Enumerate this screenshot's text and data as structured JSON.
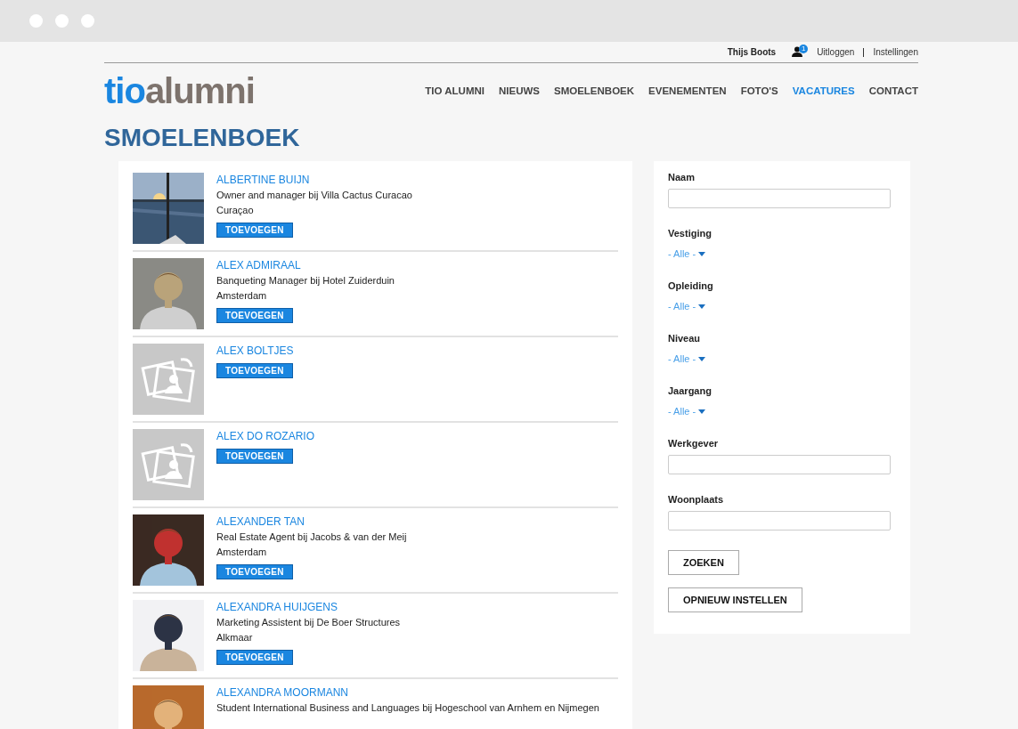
{
  "top_bar": {
    "user_name": "Thijs Boots",
    "notification_count": "1",
    "links": [
      "Uitloggen",
      "Instellingen"
    ]
  },
  "logo": {
    "part_1": "tio",
    "part_2": "alumni"
  },
  "nav": [
    {
      "label": "TIO ALUMNI",
      "selected": false
    },
    {
      "label": "NIEUWS",
      "selected": false
    },
    {
      "label": "SMOELENBOEK",
      "selected": false
    },
    {
      "label": "EVENEMENTEN",
      "selected": false
    },
    {
      "label": "FOTO'S",
      "selected": false
    },
    {
      "label": "VACATURES",
      "selected": true
    },
    {
      "label": "CONTACT",
      "selected": false
    }
  ],
  "page_title": "SMOELENBOEK",
  "people": [
    {
      "kind": "picture",
      "name": "ALBERTINE BUIJN",
      "job": "Owner and manager bij Villa Cactus Curacao",
      "city": "Curaçao",
      "button": "TOEVOEGEN"
    },
    {
      "kind": "picture",
      "name": "ALEX ADMIRAAL",
      "job": "Banqueting Manager bij Hotel Zuiderduin",
      "city": "Amsterdam",
      "button": "TOEVOEGEN"
    },
    {
      "kind": "placeholder",
      "name": "ALEX BOLTJES",
      "button": "TOEVOEGEN"
    },
    {
      "kind": "placeholder",
      "name": "ALEX DO ROZARIO",
      "button": "TOEVOEGEN"
    },
    {
      "kind": "picture",
      "name": "ALEXANDER TAN",
      "job": "Real Estate Agent bij Jacobs & van der Meij",
      "city": "Amsterdam",
      "button": "TOEVOEGEN"
    },
    {
      "kind": "picture",
      "name": "ALEXANDRA HUIJGENS",
      "job": "Marketing Assistent bij De Boer Structures",
      "city": "Alkmaar",
      "button": "TOEVOEGEN"
    },
    {
      "kind": "picture",
      "name": "ALEXANDRA MOORMANN",
      "job": "Student International Business and Languages bij Hogeschool van Arnhem en Nijmegen"
    }
  ],
  "filters": [
    {
      "kind": "text",
      "label": "Naam"
    },
    {
      "kind": "select",
      "label": "Vestiging",
      "value": "- Alle -"
    },
    {
      "kind": "select",
      "label": "Opleiding",
      "value": "- Alle -"
    },
    {
      "kind": "select",
      "label": "Niveau",
      "value": "- Alle -"
    },
    {
      "kind": "select",
      "label": "Jaargang",
      "value": "- Alle -"
    },
    {
      "kind": "text",
      "label": "Werkgever"
    },
    {
      "kind": "text",
      "label": "Woonplaats"
    }
  ],
  "buttons": [
    "ZOEKEN",
    "OPNIEUW INSTELLEN"
  ]
}
